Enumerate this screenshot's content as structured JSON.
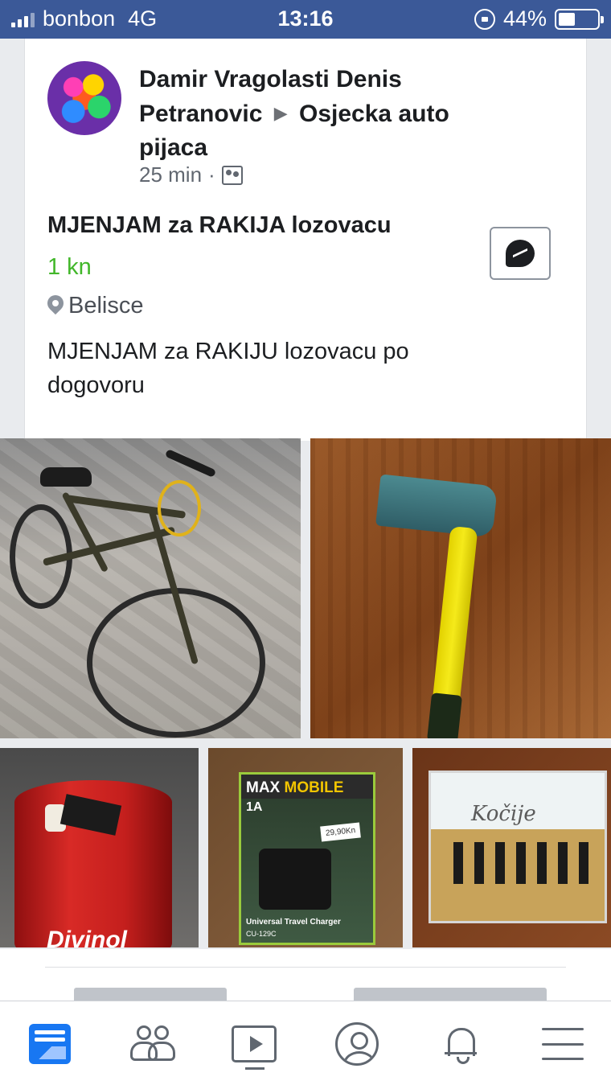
{
  "status_bar": {
    "carrier": "bonbon",
    "network": "4G",
    "time": "13:16",
    "battery": "44%",
    "battery_level": 0.44
  },
  "post": {
    "author": "Damir Vragolasti Denis Petranovic",
    "group": "Osjecka auto pijaca",
    "time_ago": "25 min",
    "separator": "·",
    "title": "MJENJAM za RAKIJA lozovacu",
    "price": "1 kn",
    "location": "Belisce",
    "description": "MJENJAM za RAKIJU lozovacu po dogovoru"
  },
  "photos": {
    "barrel_brand": "Divinol",
    "charger_brand_a": "MAX",
    "charger_brand_b": "MOBILE",
    "charger_amp": "1A",
    "charger_price": "29,90Kn",
    "charger_desc": "Universal Travel Charger",
    "charger_model": "CU-129C",
    "cd_title": "Kočije"
  },
  "icons": {
    "messenger": "messenger-icon",
    "location": "pin-icon",
    "audience": "group-icon"
  },
  "colors": {
    "status_bar": "#3b5998",
    "price": "#42b72a",
    "active_tab": "#1877f2"
  }
}
